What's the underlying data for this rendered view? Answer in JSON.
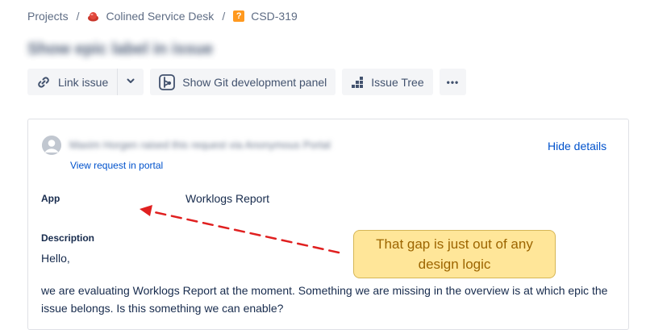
{
  "breadcrumb": {
    "projects": "Projects",
    "separator": "/",
    "project_name": "Colined Service Desk",
    "project_icon": "service-desk-project-icon",
    "issue_key": "CSD-319",
    "issue_type_icon": "question-issue-type-icon"
  },
  "issue": {
    "title": "Show epic label in issue"
  },
  "toolbar": {
    "link_issue": "Link issue",
    "git_panel": "Show Git development panel",
    "issue_tree": "Issue Tree",
    "more": "•••"
  },
  "request": {
    "reporter_line": "Maxim Horgen raised this request via Anonymous Portal",
    "view_portal": "View request in portal",
    "hide_details": "Hide details"
  },
  "fields": {
    "app_label": "App",
    "app_value": "Worklogs Report",
    "description_label": "Description",
    "description_greeting": "Hello,",
    "description_line1": "we are evaluating Worklogs Report at the moment. Something we are missing in the overview is at which epic the",
    "description_line2": "issue belongs. Is this something we can enable?"
  },
  "annotation": {
    "callout_text": "That gap is just out of any design logic",
    "arrow_color": "#e02020",
    "callout_bg": "#ffe699"
  },
  "colors": {
    "link": "#0052cc",
    "text": "#172b4d",
    "muted": "#5e6c84",
    "button_bg": "#f4f5f7"
  }
}
